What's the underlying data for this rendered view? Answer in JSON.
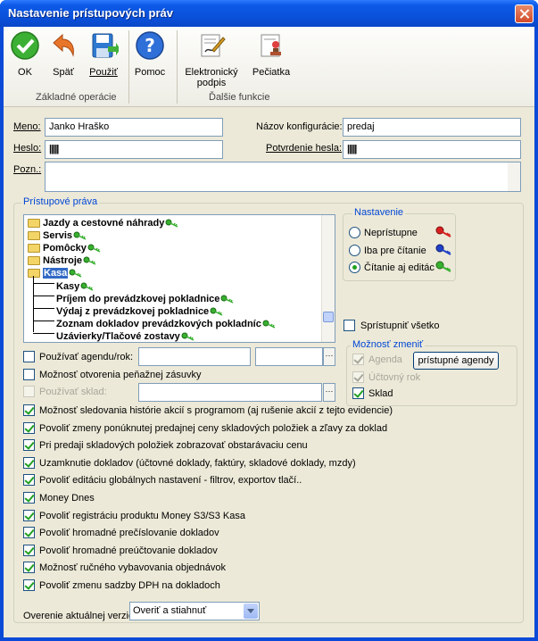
{
  "window": {
    "title": "Nastavenie prístupových práv"
  },
  "toolbar": {
    "ok": "OK",
    "back": "Späť",
    "apply": "Použiť",
    "help": "Pomoc",
    "signature": "Elektronický",
    "signature2": "podpis",
    "stamp": "Pečiatka",
    "group_basic": "Základné operácie",
    "group_more": "Ďalšie funkcie"
  },
  "form": {
    "name_label": "Meno:",
    "name_value": "Janko Hraško",
    "config_label": "Názov konfigurácie:",
    "config_value": "predaj",
    "password_label": "Heslo:",
    "password_value": "|||||",
    "confirm_label": "Potvrdenie hesla:",
    "confirm_value": "|||||",
    "note_label": "Pozn.:",
    "note_value": ""
  },
  "rights": {
    "title": "Prístupové práva",
    "tree": [
      {
        "label": "Jazdy a cestovné náhrady",
        "level": 0
      },
      {
        "label": "Servis",
        "level": 0
      },
      {
        "label": "Pomôcky",
        "level": 0
      },
      {
        "label": "Nástroje",
        "level": 0
      },
      {
        "label": "Kasa",
        "level": 0
      },
      {
        "label": "Kasy",
        "level": 1
      },
      {
        "label": "Príjem do prevádzkovej pokladnice",
        "level": 1
      },
      {
        "label": "Výdaj z prevádzkovej pokladnice",
        "level": 1
      },
      {
        "label": "Zoznam dokladov prevádzkových pokladníc",
        "level": 1
      },
      {
        "label": "Uzávierky/Tlačové zostavy",
        "level": 1
      }
    ],
    "settings_title": "Nastavenie",
    "opt_none": "Neprístupne",
    "opt_read": "Iba pre čítanie",
    "opt_rw": "Čítanie aj editác",
    "share_all": "Sprístupniť všetko",
    "change_title": "Možnosť zmeniť",
    "change_agenda": "Agenda",
    "change_year": "Účtovný rok",
    "change_stock": "Sklad",
    "access_agenda_btn": "prístupné agendy",
    "use_agenda": "Používať agendu/rok:",
    "cash_drawer": "Možnosť otvorenia peňažnej zásuvky",
    "use_stock": "Používať sklad:"
  },
  "options": [
    "Možnosť sledovania histórie akcií s programom (aj rušenie akcií z tejto evidencie)",
    "Povoliť zmeny ponúknutej predajnej ceny skladových položiek a zľavy za doklad",
    "Pri predaji skladových položiek zobrazovať obstarávaciu cenu",
    "Uzamknutie dokladov (účtovné doklady, faktúry, skladové doklady, mzdy)",
    "Povoliť editáciu globálnych nastavení - filtrov, exportov tlačí..",
    "Money Dnes",
    "Povoliť registráciu produktu Money S3/S3 Kasa",
    "Povoliť hromadné prečíslovanie dokladov",
    "Povoliť hromadné preúčtovanie dokladov",
    "Možnosť ručného vybavovania objednávok",
    "Povoliť zmenu sadzby DPH na dokladoch"
  ],
  "version": {
    "label": "Overenie aktuálnej verzie",
    "value": "Overiť a stiahnuť"
  }
}
